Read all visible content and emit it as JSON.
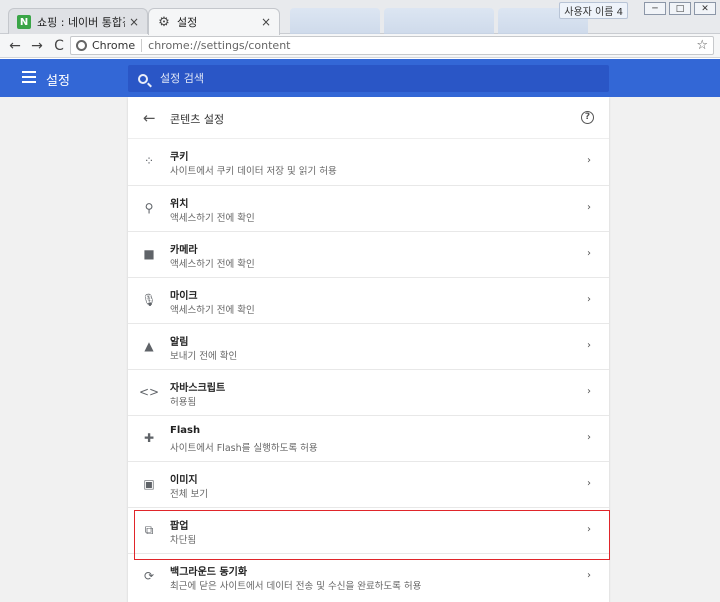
{
  "browser": {
    "tabs": [
      {
        "icon": "N",
        "title": "쇼핑 : 네이버 통합검색",
        "close": "×"
      },
      {
        "icon": "⚙",
        "title": "설정",
        "close": "×"
      }
    ],
    "profile": "사용자 이름 4",
    "window_controls": [
      "─",
      "□",
      "✕"
    ],
    "nav": {
      "back": "←",
      "forward": "→",
      "reload": "C"
    },
    "address": {
      "chip": "Chrome",
      "url": "chrome://settings/content",
      "star": "☆"
    }
  },
  "settings": {
    "title": "설정",
    "search_placeholder": "설정 검색"
  },
  "content_settings": {
    "title": "콘텐츠 설정",
    "back": "←",
    "help": "?",
    "items": [
      {
        "icon": "cookie-icon",
        "glyph": "⁘",
        "name": "쿠키",
        "desc": "사이트에서 쿠키 데이터 저장 및 읽기 허용"
      },
      {
        "icon": "location-icon",
        "glyph": "⚲",
        "name": "위치",
        "desc": "액세스하기 전에 확인"
      },
      {
        "icon": "camera-icon",
        "glyph": "■",
        "name": "카메라",
        "desc": "액세스하기 전에 확인"
      },
      {
        "icon": "microphone-icon",
        "glyph": "🎙",
        "name": "마이크",
        "desc": "액세스하기 전에 확인"
      },
      {
        "icon": "bell-icon",
        "glyph": "▲",
        "name": "알림",
        "desc": "보내기 전에 확인"
      },
      {
        "icon": "code-icon",
        "glyph": "<>",
        "name": "자바스크립트",
        "desc": "허용됨"
      },
      {
        "icon": "puzzle-icon",
        "glyph": "✚",
        "name": "Flash",
        "desc": "사이트에서 Flash를 실행하도록 허용"
      },
      {
        "icon": "image-icon",
        "glyph": "▣",
        "name": "이미지",
        "desc": "전체 보기"
      },
      {
        "icon": "popup-icon",
        "glyph": "⧉",
        "name": "팝업",
        "desc": "차단됨"
      },
      {
        "icon": "sync-icon",
        "glyph": "⟳",
        "name": "백그라운드 동기화",
        "desc": "최근에 닫은 사이트에서 데이터 전송 및 수신을 완료하도록 허용"
      }
    ],
    "arrow": "›"
  },
  "colors": {
    "accent": "#3367d6",
    "highlight": "#e0252a"
  }
}
